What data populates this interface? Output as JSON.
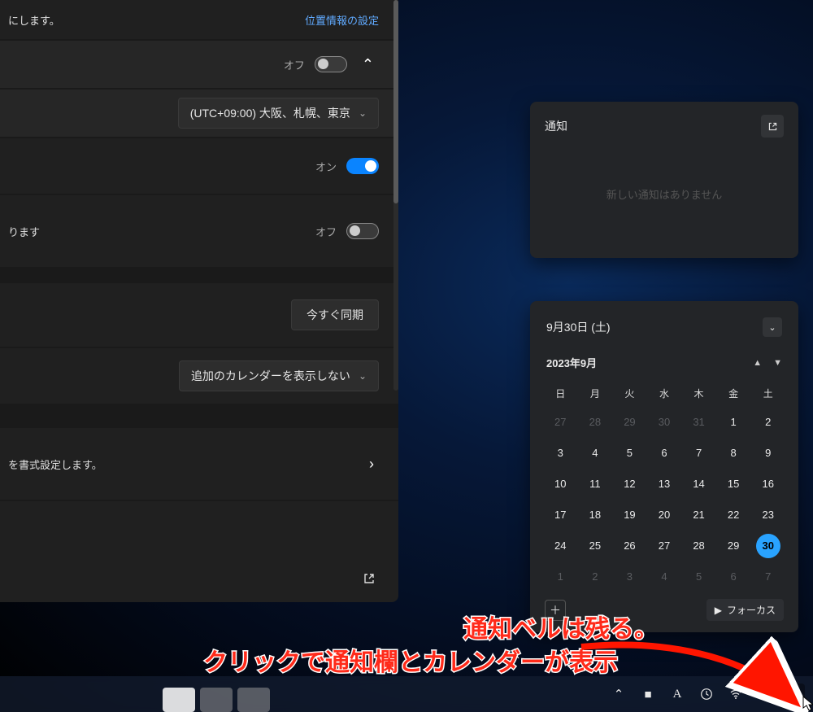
{
  "settings": {
    "header_desc": "にします。",
    "location_settings_link": "位置情報の設定",
    "toggle_off_label": "オフ",
    "toggle_on_label": "オン",
    "timezone_value": "(UTC+09:00) 大阪、札幌、東京",
    "desc_row3": "ります",
    "sync_now_label": "今すぐ同期",
    "additional_cal_label": "追加のカレンダーを表示しない",
    "format_desc": "を書式設定します。"
  },
  "notif": {
    "title": "通知",
    "empty": "新しい通知はありません"
  },
  "cal": {
    "full_date": "9月30日 (土)",
    "month_label": "2023年9月",
    "dow": [
      "日",
      "月",
      "火",
      "水",
      "木",
      "金",
      "土"
    ],
    "days": [
      {
        "n": "27",
        "outside": true
      },
      {
        "n": "28",
        "outside": true
      },
      {
        "n": "29",
        "outside": true
      },
      {
        "n": "30",
        "outside": true
      },
      {
        "n": "31",
        "outside": true
      },
      {
        "n": "1"
      },
      {
        "n": "2"
      },
      {
        "n": "3"
      },
      {
        "n": "4"
      },
      {
        "n": "5"
      },
      {
        "n": "6"
      },
      {
        "n": "7"
      },
      {
        "n": "8"
      },
      {
        "n": "9"
      },
      {
        "n": "10"
      },
      {
        "n": "11"
      },
      {
        "n": "12"
      },
      {
        "n": "13"
      },
      {
        "n": "14"
      },
      {
        "n": "15"
      },
      {
        "n": "16"
      },
      {
        "n": "17"
      },
      {
        "n": "18"
      },
      {
        "n": "19"
      },
      {
        "n": "20"
      },
      {
        "n": "21"
      },
      {
        "n": "22"
      },
      {
        "n": "23"
      },
      {
        "n": "24"
      },
      {
        "n": "25"
      },
      {
        "n": "26"
      },
      {
        "n": "27"
      },
      {
        "n": "28"
      },
      {
        "n": "29"
      },
      {
        "n": "30",
        "today": true
      },
      {
        "n": "1",
        "outside": true
      },
      {
        "n": "2",
        "outside": true
      },
      {
        "n": "3",
        "outside": true
      },
      {
        "n": "4",
        "outside": true
      },
      {
        "n": "5",
        "outside": true
      },
      {
        "n": "6",
        "outside": true
      },
      {
        "n": "7",
        "outside": true
      }
    ],
    "focus_label": "フォーカス"
  },
  "taskbar": {
    "ime": "A"
  },
  "annotation": {
    "line1": "通知ベルは残る。",
    "line2": "クリックで通知欄とカレンダーが表示"
  }
}
